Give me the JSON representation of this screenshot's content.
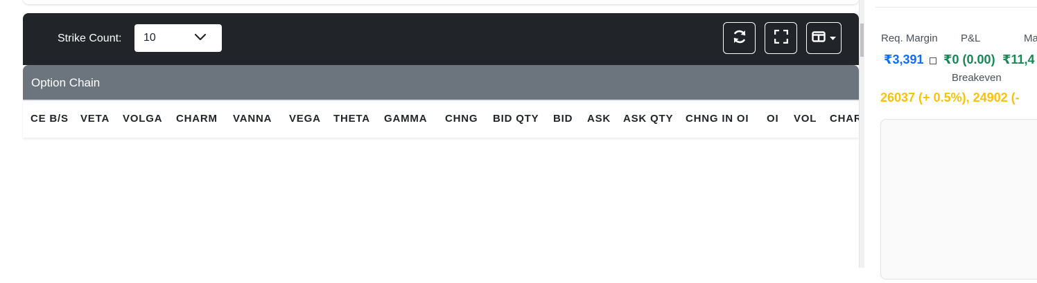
{
  "toolbar": {
    "strike_count_label": "Strike Count:",
    "strike_count_value": "10",
    "refresh_icon": "refresh-icon",
    "fullscreen_icon": "fullscreen-icon",
    "columns_icon": "columns-icon"
  },
  "option_chain": {
    "title": "Option Chain",
    "columns": [
      "CE B/S",
      "VETA",
      "VOLGA",
      "CHARM",
      "VANNA",
      "VEGA",
      "THETA",
      "GAMMA",
      "CHNG",
      "BID QTY",
      "BID",
      "ASK",
      "ASK QTY",
      "CHNG IN OI",
      "OI",
      "VOL",
      "CHAR"
    ]
  },
  "summary": {
    "req_margin_label": "Req. Margin",
    "pnl_label": "P&L",
    "max_label": "Ma",
    "req_margin_value": "₹3,391",
    "pnl_value": "₹0 (0.00)",
    "max_value": "₹11,4",
    "breakeven_label": "Breakeven",
    "breakeven_value": "26037 (+ 0.5%), 24902 (-",
    "colors": {
      "req_margin": "#0d6efd",
      "pnl": "#198754",
      "max": "#198754",
      "breakeven": "#ffc107"
    }
  }
}
